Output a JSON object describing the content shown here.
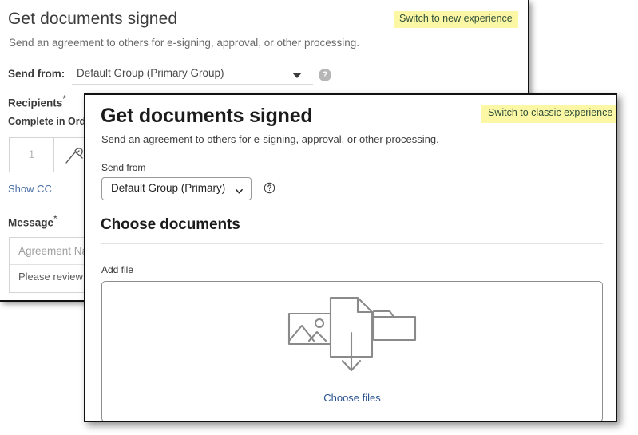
{
  "classic": {
    "title": "Get documents signed",
    "subtitle": "Send an agreement to others for e-signing, approval, or other processing.",
    "switch_label": "Switch to new experience",
    "send_from_label": "Send from:",
    "send_from_value": "Default Group (Primary Group)",
    "help_glyph": "?",
    "recipients_label": "Recipients",
    "required_mark": "*",
    "complete_in_order_label": "Complete in Order",
    "recipient_order_value": "1",
    "recipient_role_icon": "signature-pen-icon",
    "show_cc_label": "Show CC",
    "message_label": "Message",
    "message_name_placeholder": "Agreement Name",
    "message_body_value": "Please review and sign this document."
  },
  "modal": {
    "title": "Get documents signed",
    "subtitle": "Send an agreement to others for e-signing, approval, or other processing.",
    "switch_label": "Switch to classic experience",
    "send_from_label": "Send from",
    "send_from_value": "Default Group (Primary)",
    "help_icon": "question-circle-icon",
    "chevron_icon": "chevron-down-icon",
    "section_title": "Choose documents",
    "add_file_label": "Add file",
    "dropzone": {
      "image_icon": "image-file-icon",
      "upload_icon": "document-download-icon",
      "folder_icon": "folder-icon",
      "choose_files_label": "Choose files"
    }
  },
  "colors": {
    "highlight_yellow": "#fbf7a5",
    "highlight_text": "#2f4f3a",
    "link_blue": "#29528f",
    "classic_link_blue": "#4a6fa5",
    "icon_gray": "#808080",
    "border_dark": "#111111"
  }
}
